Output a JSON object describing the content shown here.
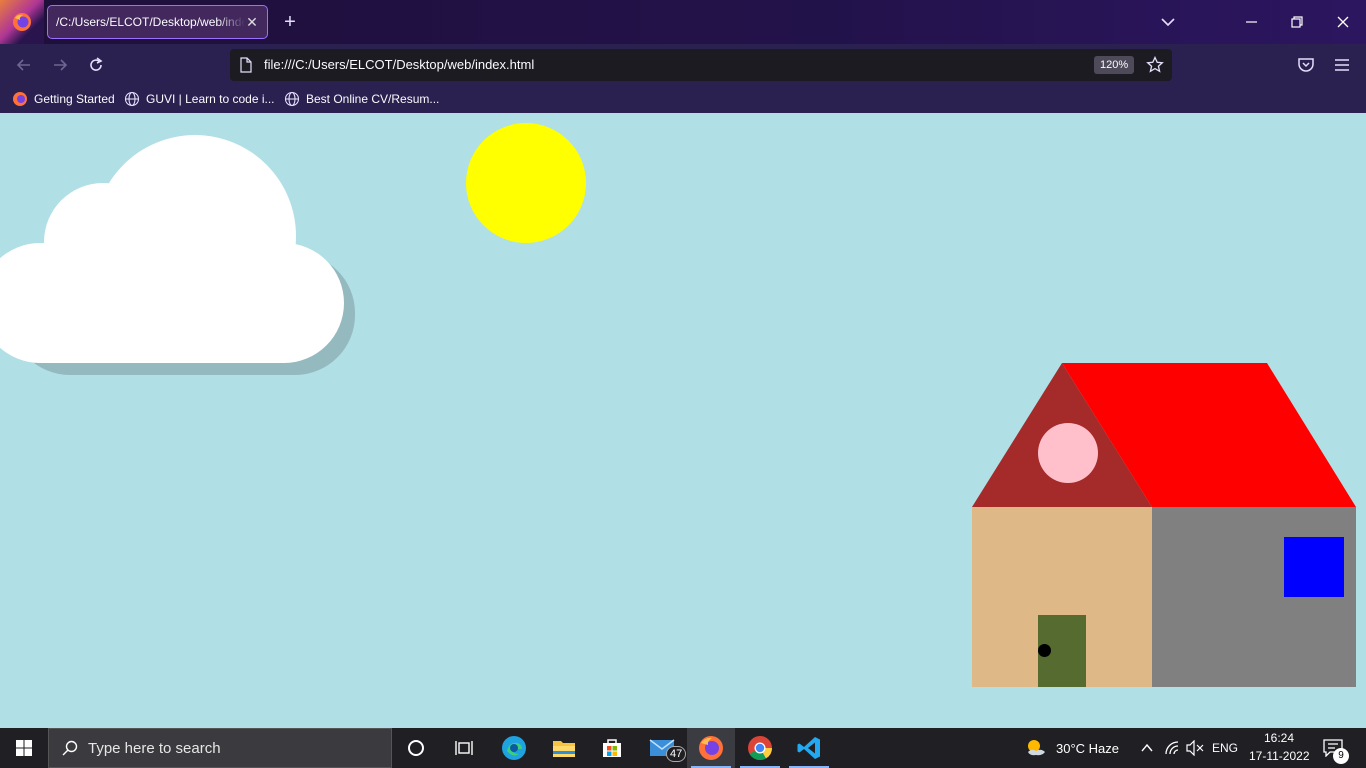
{
  "browser": {
    "tab": {
      "title": "/C:/Users/ELCOT/Desktop/web/index.html",
      "close": "✕"
    },
    "new_tab": "+",
    "url": "file:///C:/Users/ELCOT/Desktop/web/index.html",
    "zoom": "120%",
    "bookmarks": [
      {
        "label": "Getting Started",
        "icon": "firefox-icon"
      },
      {
        "label": "GUVI | Learn to code i...",
        "icon": "globe-icon"
      },
      {
        "label": "Best Online CV/Resum...",
        "icon": "globe-icon"
      }
    ]
  },
  "scene": {
    "colors": {
      "sky": "#b0dfe5",
      "cloud": "#ffffff",
      "cloud_shadow": "#94b9bf",
      "sun": "#ffff00",
      "roof_front": "#a52a2a",
      "roof_side": "#ff0000",
      "attic_window": "#ffc0cb",
      "wall_front": "#deb887",
      "wall_side": "#808080",
      "door": "#556b2f",
      "door_knob": "#000000",
      "window": "#0000ff"
    }
  },
  "taskbar": {
    "search_placeholder": "Type here to search",
    "apps": [
      "cortana-icon",
      "task-view-icon",
      "edge-icon",
      "file-explorer-icon",
      "store-icon",
      "mail-icon",
      "firefox-icon",
      "chrome-icon",
      "vscode-icon"
    ],
    "mail_badge": "47",
    "weather": "30°C  Haze",
    "language": "ENG",
    "time": "16:24",
    "date": "17-11-2022",
    "notifications": "9"
  }
}
